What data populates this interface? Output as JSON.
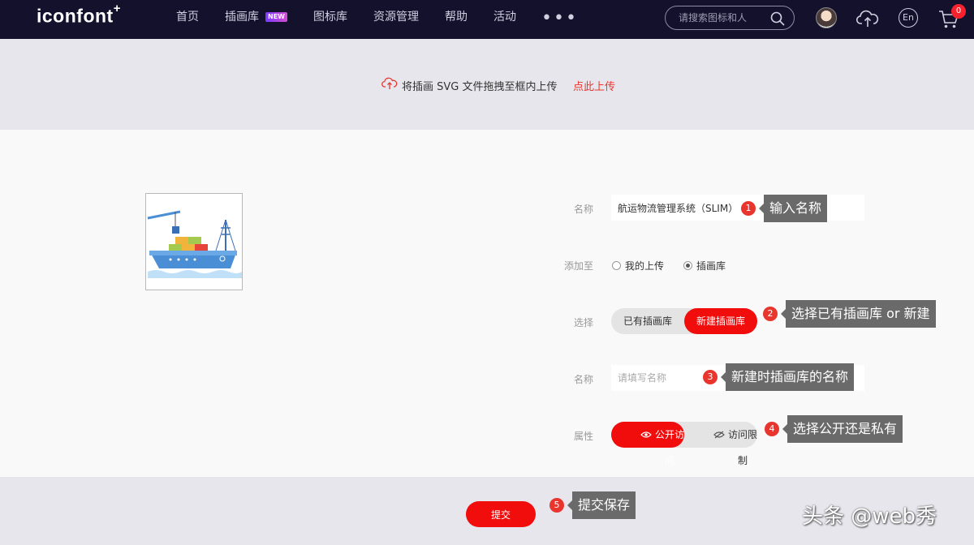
{
  "nav": {
    "logo": "iconfont",
    "logo_plus": "+",
    "items": [
      "首页",
      "插画库",
      "图标库",
      "资源管理",
      "帮助",
      "活动"
    ],
    "new_badge": "NEW",
    "more": "•••",
    "search_placeholder": "请搜索图标和人",
    "lang": "En",
    "cart_count": "0"
  },
  "upload": {
    "text": "将插画 SVG 文件拖拽至框内上传",
    "link": "点此上传"
  },
  "form": {
    "name_label": "名称",
    "name_value": "航运物流管理系统（SLIM）",
    "add_to_label": "添加至",
    "radio_options": [
      "我的上传",
      "插画库"
    ],
    "radio_selected": 1,
    "select_label": "选择",
    "select_options": [
      "已有插画库",
      "新建插画库"
    ],
    "select_active": 1,
    "new_name_label": "名称",
    "new_name_placeholder": "请填写名称",
    "attr_label": "属性",
    "attr_options": [
      "公开访问",
      "访问限制"
    ],
    "attr_active": 0
  },
  "annotations": [
    {
      "num": "1",
      "text": "输入名称"
    },
    {
      "num": "2",
      "text": "选择已有插画库 or 新建"
    },
    {
      "num": "3",
      "text": "新建时插画库的名称"
    },
    {
      "num": "4",
      "text": "选择公开还是私有"
    },
    {
      "num": "5",
      "text": "提交保存"
    }
  ],
  "footer": {
    "submit_label": "提交",
    "watermark": "头条 @web秀"
  },
  "colors": {
    "nav_bg": "#13112c",
    "accent_red": "#f20d0d",
    "link_red": "#e8362f",
    "tooltip_bg": "#6a6a6a"
  }
}
